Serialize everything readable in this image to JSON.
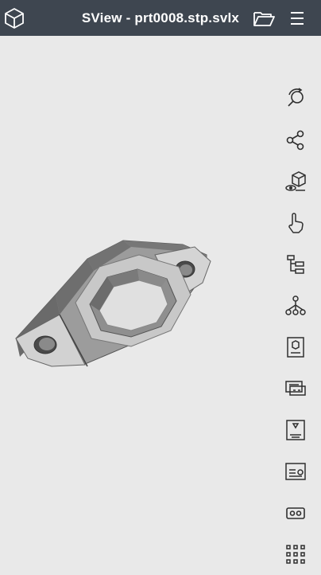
{
  "app": {
    "title": "SView - prt0008.stp.svlx"
  },
  "icons": {
    "app": "cube-icon",
    "open": "folder-open-icon",
    "menu": "hamburger-menu-icon"
  },
  "toolbar": {
    "tools": [
      "rotate-zoom-icon",
      "share-icon",
      "view-cube-icon",
      "hand-gesture-icon",
      "model-tree-icon",
      "assembly-icon",
      "properties-icon",
      "annotation-icon",
      "3d-print-icon",
      "drawing-icon",
      "vr-icon",
      "more-apps-icon"
    ]
  },
  "colors": {
    "topbar": "#3e4650",
    "background": "#e9e9e9",
    "icon": "#2f2f2f"
  }
}
